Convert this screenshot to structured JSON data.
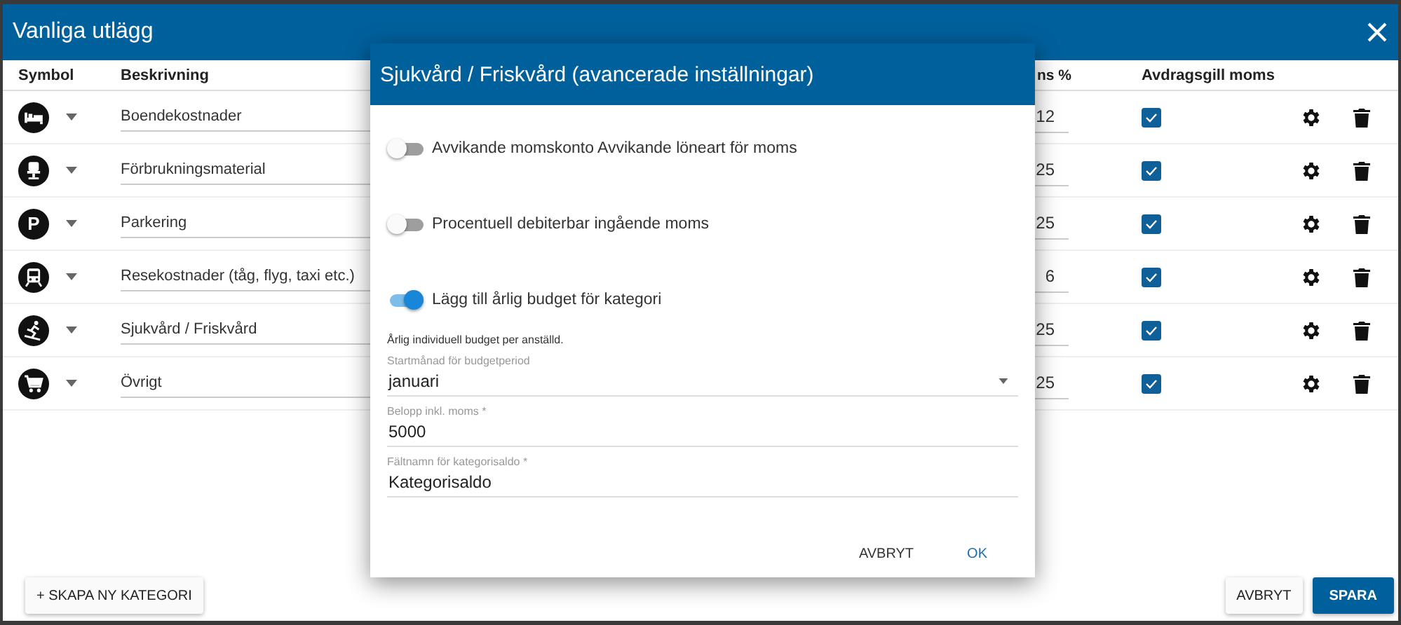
{
  "window": {
    "title": "Vanliga utlägg"
  },
  "table": {
    "columns": [
      "Symbol",
      "Beskrivning",
      "ns %",
      "Avdragsgill moms"
    ],
    "rows": [
      {
        "kind": "bed",
        "description": "Boendekostnader",
        "vat": "12",
        "deductible": true
      },
      {
        "kind": "chair",
        "description": "Förbrukningsmaterial",
        "vat": "25",
        "deductible": true
      },
      {
        "kind": "parking",
        "symbol_letter": "P",
        "description": "Parkering",
        "vat": "25",
        "deductible": true
      },
      {
        "kind": "train",
        "description": "Resekostnader (tåg, flyg, taxi etc.)",
        "vat": "6",
        "deductible": true
      },
      {
        "kind": "skier",
        "description": "Sjukvård / Friskvård",
        "vat": "25",
        "deductible": true
      },
      {
        "kind": "cart",
        "description": "Övrigt",
        "vat": "25",
        "deductible": true
      }
    ]
  },
  "footer": {
    "new_category": "+ SKAPA NY KATEGORI",
    "cancel": "AVBRYT",
    "save": "SPARA"
  },
  "dialog": {
    "title": "Sjukvård / Friskvård (avancerade inställningar)",
    "toggles": [
      {
        "label": "Avvikande momskonto Avvikande löneart för moms",
        "on": false
      },
      {
        "label": "Procentuell debiterbar ingående moms",
        "on": false
      },
      {
        "label": "Lägg till årlig budget för kategori",
        "on": true
      }
    ],
    "helper": "Årlig individuell budget per anställd.",
    "fields": [
      {
        "kind": "select",
        "label": "Startmånad för budgetperiod",
        "value": "januari"
      },
      {
        "kind": "text",
        "label": "Belopp inkl. moms *",
        "value": "5000"
      },
      {
        "kind": "text",
        "label": "Fältnamn för kategorisaldo *",
        "value": "Kategorisaldo"
      }
    ],
    "buttons": [
      {
        "label": "AVBRYT",
        "primary": false
      },
      {
        "label": "OK",
        "primary": true
      }
    ]
  }
}
